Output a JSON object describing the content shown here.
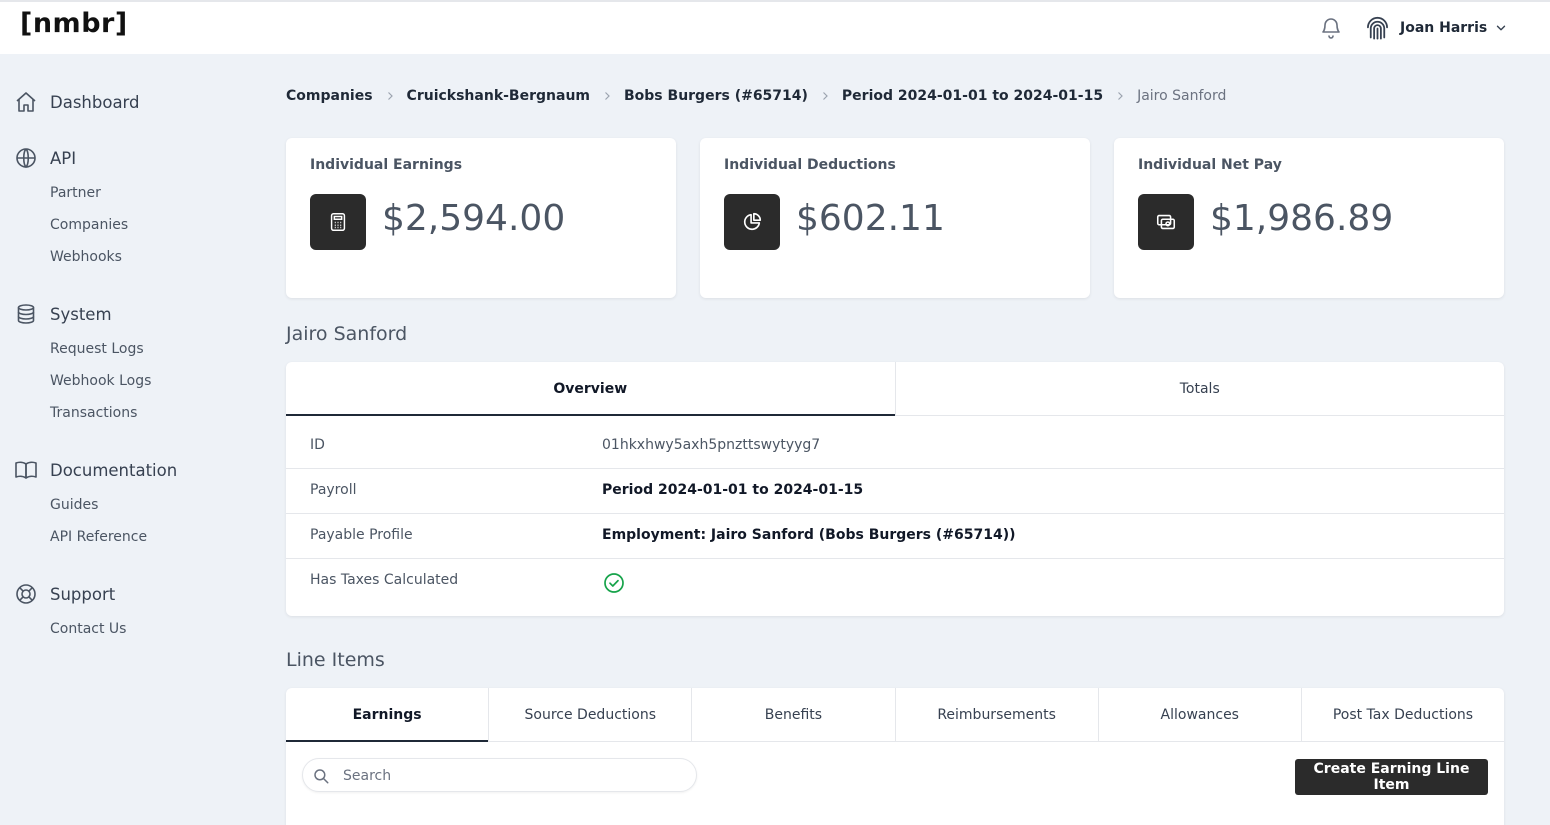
{
  "header": {
    "logo": "[nmbr]",
    "user_name": "Joan Harris"
  },
  "sidebar": {
    "sections": [
      {
        "label": "Dashboard",
        "icon": "home-icon"
      },
      {
        "label": "API",
        "icon": "globe-icon",
        "items": [
          "Partner",
          "Companies",
          "Webhooks"
        ]
      },
      {
        "label": "System",
        "icon": "database-icon",
        "items": [
          "Request Logs",
          "Webhook Logs",
          "Transactions"
        ]
      },
      {
        "label": "Documentation",
        "icon": "book-icon",
        "items": [
          "Guides",
          "API Reference"
        ]
      },
      {
        "label": "Support",
        "icon": "lifebuoy-icon",
        "items": [
          "Contact Us"
        ]
      }
    ]
  },
  "breadcrumb": [
    "Companies",
    "Cruickshank-Bergnaum",
    "Bobs Burgers (#65714)",
    "Period 2024-01-01 to 2024-01-15",
    "Jairo Sanford"
  ],
  "stats": [
    {
      "title": "Individual Earnings",
      "value": "$2,594.00",
      "icon": "calculator-icon"
    },
    {
      "title": "Individual Deductions",
      "value": "$602.11",
      "icon": "pie-chart-icon"
    },
    {
      "title": "Individual Net Pay",
      "value": "$1,986.89",
      "icon": "cash-icon"
    }
  ],
  "person": {
    "name": "Jairo Sanford",
    "tabs": [
      "Overview",
      "Totals"
    ],
    "active_tab": "Overview",
    "fields": [
      {
        "label": "ID",
        "value": "01hkxhwy5axh5pnzttswytyyg7"
      },
      {
        "label": "Payroll",
        "value": "Period 2024-01-01 to 2024-01-15"
      },
      {
        "label": "Payable Profile",
        "value": "Employment: Jairo Sanford (Bobs Burgers (#65714))"
      },
      {
        "label": "Has Taxes Calculated",
        "value": ""
      }
    ],
    "has_taxes_calculated": true
  },
  "line_items": {
    "title": "Line Items",
    "tabs": [
      "Earnings",
      "Source Deductions",
      "Benefits",
      "Reimbursements",
      "Allowances",
      "Post Tax Deductions"
    ],
    "active_tab": "Earnings",
    "search_placeholder": "Search",
    "create_button": "Create Earning Line Item"
  },
  "colors": {
    "background": "#eef2f7",
    "accent_dark": "#2b2b2b",
    "success": "#16a34a"
  }
}
